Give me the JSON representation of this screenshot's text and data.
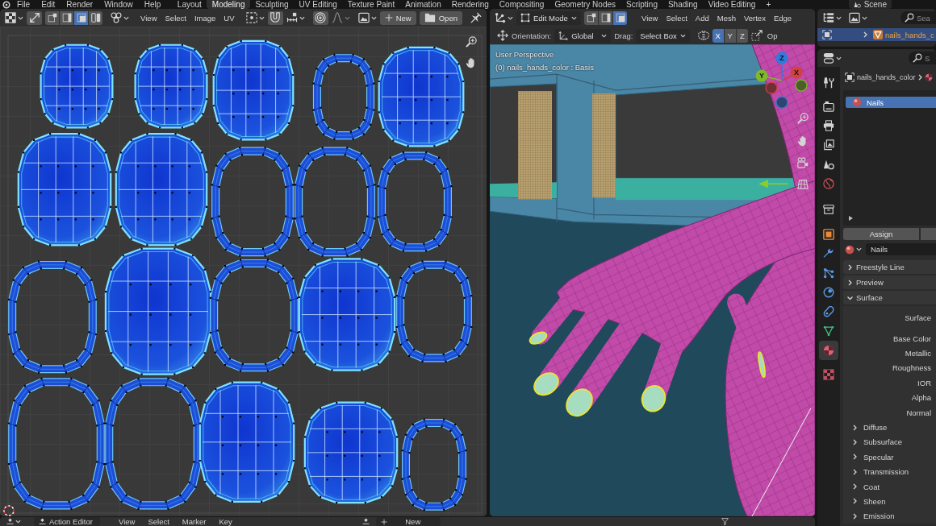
{
  "top_bar": {
    "menus": [
      "File",
      "Edit",
      "Render",
      "Window",
      "Help"
    ],
    "workspaces": [
      {
        "label": "Layout",
        "selected": false
      },
      {
        "label": "Modeling",
        "selected": true
      },
      {
        "label": "Sculpting",
        "selected": false
      },
      {
        "label": "UV Editing",
        "selected": false
      },
      {
        "label": "Texture Paint",
        "selected": false
      },
      {
        "label": "Animation",
        "selected": false
      },
      {
        "label": "Rendering",
        "selected": false
      },
      {
        "label": "Compositing",
        "selected": false
      },
      {
        "label": "Geometry Nodes",
        "selected": false
      },
      {
        "label": "Scripting",
        "selected": false
      },
      {
        "label": "Shading",
        "selected": false
      },
      {
        "label": "Video Editing",
        "selected": false
      }
    ],
    "add_workspace": "+",
    "scene": "Scene"
  },
  "uv_editor": {
    "select_modes": [
      {
        "selected": false
      },
      {
        "selected": false
      },
      {
        "selected": true
      },
      {
        "selected": false
      }
    ],
    "menus": [
      "View",
      "Select",
      "Image",
      "UV"
    ],
    "new_button": "New",
    "open_button": "Open"
  },
  "viewport": {
    "mode": "Edit Mode",
    "select_modes": [
      {
        "selected": false
      },
      {
        "selected": false
      },
      {
        "selected": true
      }
    ],
    "menus": [
      "View",
      "Select",
      "Add",
      "Mesh",
      "Vertex",
      "Edge"
    ],
    "orientation_label": "Orientation:",
    "orientation": "Global",
    "drag_label": "Drag:",
    "drag": "Select Box",
    "mirror_axes": [
      {
        "label": "X",
        "selected": true
      },
      {
        "label": "Y",
        "selected": false
      },
      {
        "label": "Z",
        "selected": false
      }
    ],
    "cut_menu": "Op",
    "view_name": "User Perspective",
    "object_info": "(0) nails_hands_color : Basis",
    "gizmo_axes": [
      "X",
      "Y",
      "Z"
    ]
  },
  "outliner": {
    "search_placeholder": "Sea",
    "rows": [
      {
        "name": "nails_hands_c",
        "selected": true
      }
    ]
  },
  "properties": {
    "search_placeholder": "S",
    "tabs": [
      {
        "selected": false
      },
      {
        "selected": false
      },
      {
        "selected": false
      },
      {
        "selected": false
      },
      {
        "selected": false
      },
      {
        "selected": false
      },
      {
        "selected": false
      },
      {
        "selected": false
      },
      {
        "selected": false
      },
      {
        "selected": false
      },
      {
        "selected": false
      },
      {
        "selected": false
      },
      {
        "selected": false
      },
      {
        "selected": true
      },
      {
        "selected": false
      }
    ],
    "breadcrumb": "nails_hands_color",
    "material_slots": [
      {
        "name": "Nails",
        "selected": true
      }
    ],
    "assign_button": "Assign",
    "material": "Nails",
    "panels": [
      {
        "label": "Freestyle Line",
        "expanded": false
      },
      {
        "label": "Preview",
        "expanded": false
      },
      {
        "label": "Surface",
        "expanded": true,
        "fields": [
          "Surface",
          "Base Color",
          "Metallic",
          "Roughness",
          "IOR",
          "Alpha",
          "Normal"
        ],
        "children": [
          {
            "label": "Diffuse",
            "expanded": false
          },
          {
            "label": "Subsurface",
            "expanded": false
          },
          {
            "label": "Specular",
            "expanded": false
          },
          {
            "label": "Transmission",
            "expanded": false
          },
          {
            "label": "Coat",
            "expanded": false
          },
          {
            "label": "Sheen",
            "expanded": false
          },
          {
            "label": "Emission",
            "expanded": false
          }
        ]
      }
    ]
  },
  "bottom_bar": {
    "editor": "Action Editor",
    "menus": [
      "View",
      "Select",
      "Marker",
      "Key"
    ],
    "new_button": "New"
  }
}
